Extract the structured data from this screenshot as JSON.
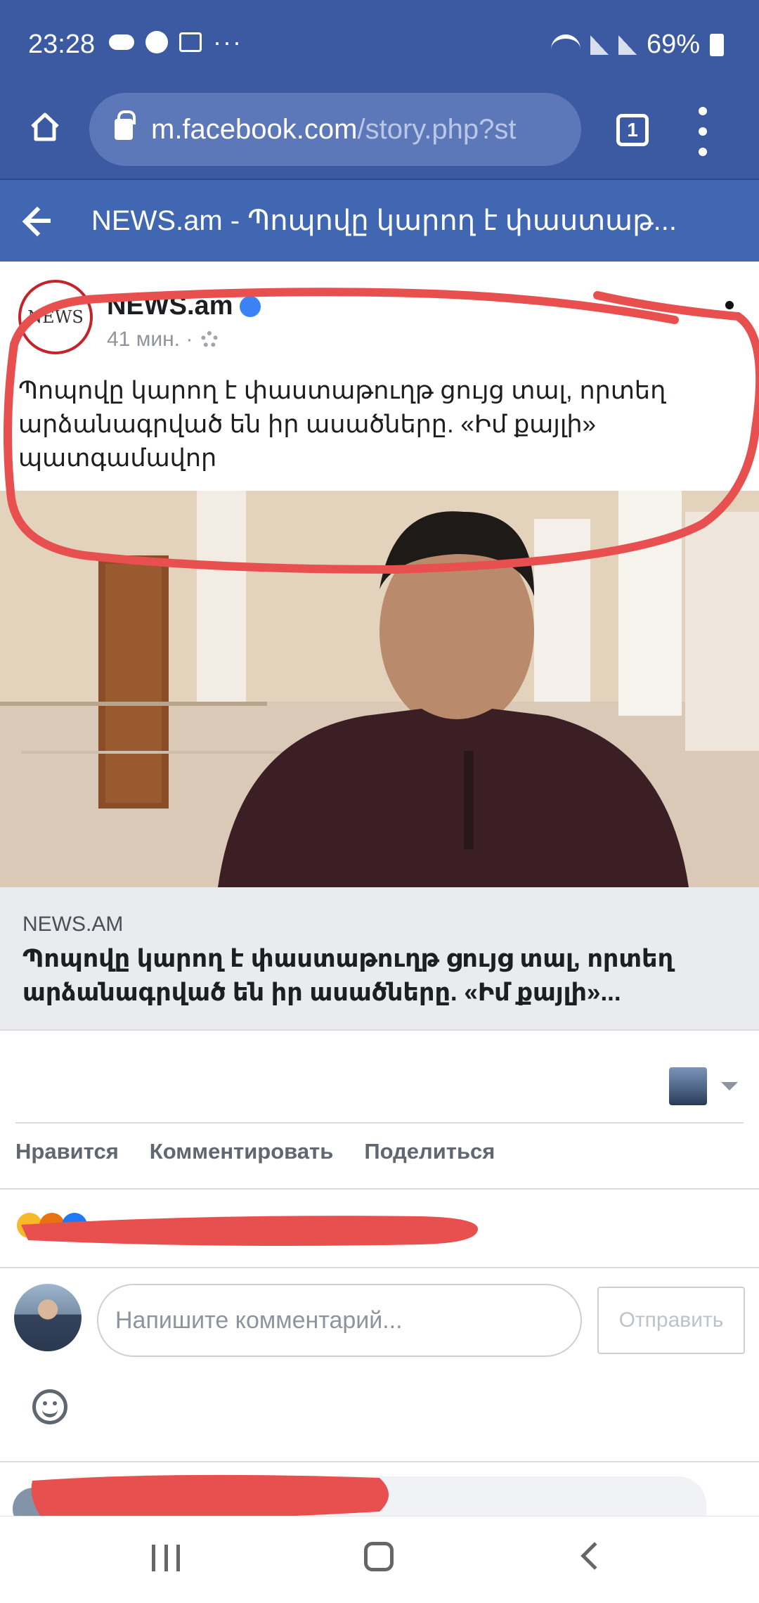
{
  "status_bar": {
    "time": "23:28",
    "battery": "69%"
  },
  "browser": {
    "url_host": "m.facebook.com",
    "url_path": "/story.php?st",
    "tab_count": "1"
  },
  "page_header": {
    "title": "NEWS.am - Պոպովը կարող է փաստաթ..."
  },
  "post": {
    "logo_text": "NEWS",
    "author": "NEWS.am",
    "time": "41 мин. ·",
    "text": "Պոպովը կարող է փաստաթուղթ ցույց տալ, որտեղ արձանագրված են իր ասածները. «Իմ քայլի» պատգամավոր"
  },
  "link_preview": {
    "source": "NEWS.AM",
    "headline": "Պոպովը կարող է փաստաթուղթ ցույց տալ, որտեղ արձանագրված են իր ասածները. «Իմ քայլի»..."
  },
  "actions": {
    "like": "Нравится",
    "comment": "Комментировать",
    "share": "Поделиться"
  },
  "composer": {
    "placeholder": "Напишите комментарий...",
    "send": "Отправить"
  },
  "colors": {
    "header_blue": "#3b5aa2",
    "page_header_blue": "#4167b2",
    "annotation_red": "#e8504f"
  }
}
